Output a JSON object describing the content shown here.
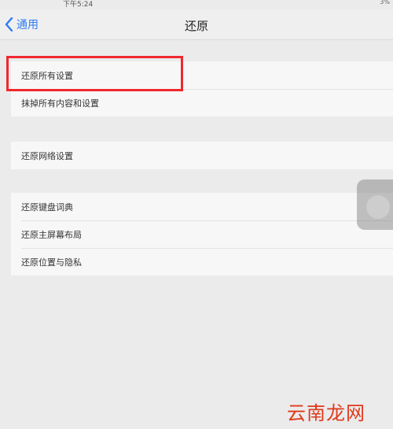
{
  "status_bar": {
    "time": "下午5:24",
    "battery": "3%"
  },
  "nav": {
    "back_label": "通用",
    "title": "还原"
  },
  "groups": [
    {
      "items": [
        {
          "label": "还原所有设置"
        },
        {
          "label": "抹掉所有内容和设置"
        }
      ]
    },
    {
      "items": [
        {
          "label": "还原网络设置"
        }
      ]
    },
    {
      "items": [
        {
          "label": "还原键盘词典"
        },
        {
          "label": "还原主屏幕布局"
        },
        {
          "label": "还原位置与隐私"
        }
      ]
    }
  ],
  "watermark": "云南龙网",
  "colors": {
    "accent": "#2f7bf0",
    "highlight": "#f0282e",
    "background": "#ebebec"
  }
}
